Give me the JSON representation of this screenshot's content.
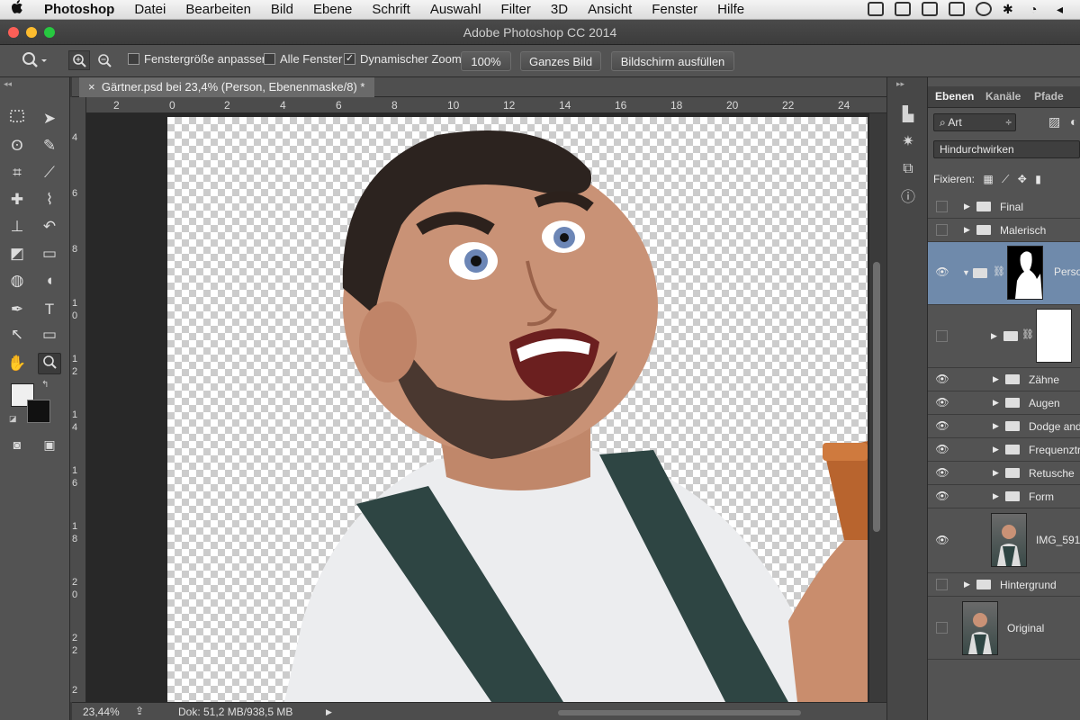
{
  "menubar": {
    "apple": "",
    "items": [
      "Photoshop",
      "Datei",
      "Bearbeiten",
      "Bild",
      "Ebene",
      "Schrift",
      "Auswahl",
      "Filter",
      "3D",
      "Ansicht",
      "Fenster",
      "Hilfe"
    ]
  },
  "window": {
    "title": "Adobe Photoshop CC 2014"
  },
  "options": {
    "fit_window": "Fenstergröße anpassen",
    "all_windows": "Alle Fenster",
    "scrubby_zoom": "Dynamischer Zoom",
    "scrubby_checked": "✓",
    "btn_100": "100%",
    "btn_fit": "Ganzes Bild",
    "btn_fill": "Bildschirm ausfüllen"
  },
  "document": {
    "tab_close": "×",
    "tab_label": "Gärtner.psd bei 23,4% (Person, Ebenenmaske/8) *"
  },
  "hruler": [
    "2",
    "0",
    "2",
    "4",
    "6",
    "8",
    "10",
    "12",
    "14",
    "16",
    "18",
    "20",
    "22",
    "24"
  ],
  "vruler": [
    "4",
    "6",
    "8",
    "1 0",
    "1 2",
    "1 4",
    "1 6",
    "1 8",
    "2 0",
    "2 2",
    "2"
  ],
  "status": {
    "zoom": "23,44%",
    "doc": "Dok: 51,2 MB/938,5 MB",
    "arrow": "▶"
  },
  "layers_panel": {
    "tabs": [
      "Ebenen",
      "Kanäle",
      "Pfade"
    ],
    "filter": "Art",
    "blend": "Hindurchwirken",
    "lock_label": "Fixieren:",
    "layers": [
      {
        "name": "Final",
        "visible": false
      },
      {
        "name": "Malerisch",
        "visible": false
      },
      {
        "name": "Perso",
        "visible": true,
        "selected": true
      },
      {
        "name": "",
        "visible": false
      },
      {
        "name": "Zähne",
        "visible": true
      },
      {
        "name": "Augen",
        "visible": true
      },
      {
        "name": "Dodge and",
        "visible": true
      },
      {
        "name": "Frequenztr",
        "visible": true
      },
      {
        "name": "Retusche",
        "visible": true
      },
      {
        "name": "Form",
        "visible": true
      },
      {
        "name": "IMG_591",
        "visible": true
      },
      {
        "name": "Hintergrund",
        "visible": false
      },
      {
        "name": "Original",
        "visible": false
      }
    ]
  },
  "colors": {
    "selection": "#6f8aab",
    "panel": "#535353"
  },
  "icons": [
    "apple-icon",
    "zoom-tool-icon",
    "marquee-icon",
    "move-icon",
    "lasso-icon",
    "quick-select-icon",
    "crop-icon",
    "eyedropper-icon",
    "healing-icon",
    "brush-icon",
    "stamp-icon",
    "history-brush-icon",
    "eraser-icon",
    "gradient-icon",
    "blur-icon",
    "dodge-icon",
    "pen-icon",
    "type-icon",
    "path-select-icon",
    "shape-icon",
    "hand-icon",
    "zoom-icon",
    "eye-icon",
    "folder-icon",
    "link-icon"
  ]
}
